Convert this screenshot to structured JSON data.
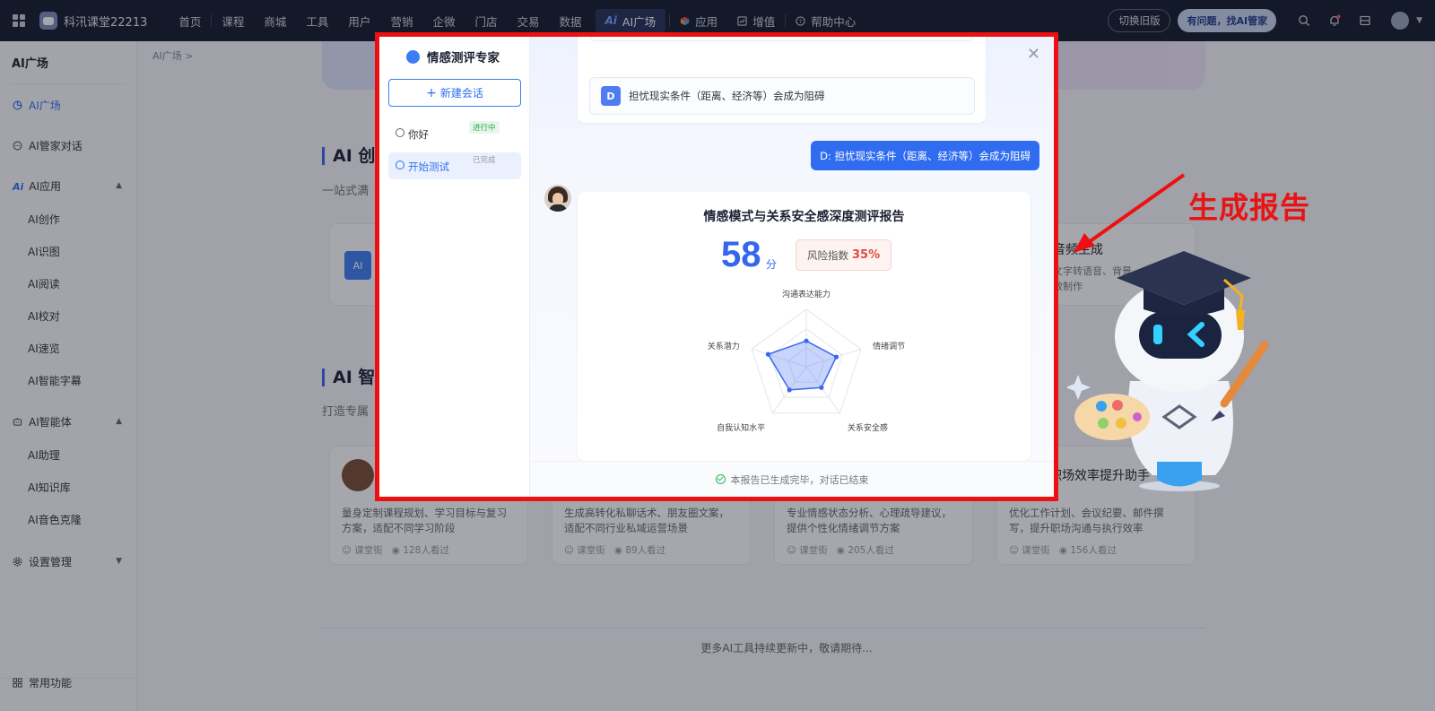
{
  "topbar": {
    "brand": "科汛课堂22213",
    "nav": [
      "首页",
      "课程",
      "商城",
      "工具",
      "用户",
      "营销",
      "企微",
      "门店",
      "交易",
      "数据"
    ],
    "nav_active": "AI广场",
    "nav_extra": [
      "应用",
      "增值",
      "帮助中心"
    ],
    "old_version": "切换旧版",
    "butler": "有问题，找AI管家"
  },
  "sidebar": {
    "title": "AI广场",
    "items": [
      {
        "label": "AI广场",
        "active": true
      },
      {
        "label": "AI管家对话"
      },
      {
        "label": "AI应用"
      },
      {
        "label": "AI智能体"
      },
      {
        "label": "设置管理"
      }
    ],
    "ai_apps": [
      "AI创作",
      "AI识图",
      "AI阅读",
      "AI校对",
      "AI速览",
      "AI智能字幕"
    ],
    "ai_agents": [
      "AI助理",
      "AI知识库",
      "AI音色克隆"
    ],
    "bottom": "常用功能"
  },
  "main": {
    "breadcrumb": "AI广场",
    "sec1_title": "AI 创",
    "sec1_sub": "一站式满",
    "sec2_title": "AI 智",
    "sec2_sub": "打造专属",
    "tool_audio_title": "音频生成",
    "tool_audio_desc": "文字转语音、背景效制作",
    "cards": [
      {
        "desc": "量身定制课程规划、学习目标与复习方案，适配不同学习阶段",
        "author": "课堂街",
        "views": "128人看过"
      },
      {
        "desc": "生成高转化私聊话术、朋友圈文案，适配不同行业私域运营场景",
        "author": "课堂街",
        "views": "89人看过"
      },
      {
        "desc": "专业情感状态分析、心理疏导建议，提供个性化情绪调节方案",
        "author": "课堂街",
        "views": "205人看过"
      },
      {
        "title": "职场效率提升助手",
        "desc": "优化工作计划、会议纪要、邮件撰写，提升职场沟通与执行效率",
        "author": "课堂街",
        "views": "156人看过"
      }
    ],
    "footer": "更多AI工具持续更新中，敬请期待..."
  },
  "modal": {
    "title": "情感测评专家",
    "new_chat": "新建会话",
    "conversations": [
      {
        "label": "你好",
        "badge": "进行中",
        "active": false
      },
      {
        "label": "开始测试",
        "badge": "已完成",
        "active": true
      }
    ],
    "option_letter": "D",
    "option_text": "担忧现实条件（距离、经济等）会成为阻碍",
    "user_message": "D: 担忧现实条件（距离、经济等）会成为阻碍",
    "report": {
      "title": "情感模式与关系安全感深度测评报告",
      "score": "58",
      "score_unit": "分",
      "risk_label": "风险指数",
      "risk_value": "35%",
      "radar_labels": [
        "沟通表达能力",
        "情绪调节",
        "关系安全感",
        "自我认知水平",
        "关系潜力"
      ]
    },
    "footer": "本报告已生成完毕，对话已结束"
  },
  "annotation": {
    "text": "生成报告",
    "color": "#e81414"
  },
  "chart_data": {
    "type": "radar",
    "categories": [
      "沟通表达能力",
      "情绪调节",
      "关系安全感",
      "自我认知水平",
      "关系潜力"
    ],
    "values": [
      0.45,
      0.55,
      0.45,
      0.5,
      0.7
    ],
    "ylim": [
      0,
      1
    ],
    "color": "#3a66f0"
  }
}
